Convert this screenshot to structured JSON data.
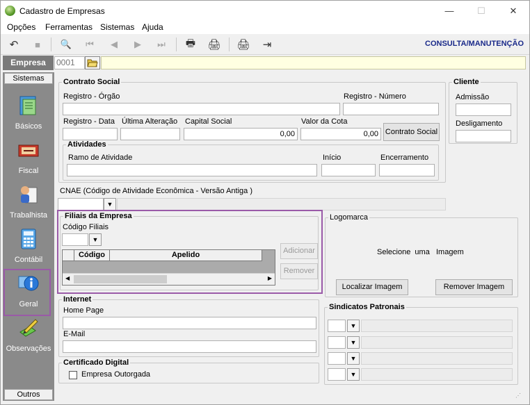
{
  "window": {
    "title": "Cadastro de Empresas",
    "min_glyph": "—",
    "max_glyph": "☐",
    "close_glyph": "✕"
  },
  "menu": [
    "Opções",
    "Ferramentas",
    "Sistemas",
    "Ajuda"
  ],
  "toolbar": {
    "mode_label": "CONSULTA/MANUTENÇÃO",
    "undo": "↶",
    "stop": "■",
    "preview": "🔍",
    "first": "⏮",
    "prev": "◀",
    "next": "▶",
    "last": "⏭",
    "print": "🖶",
    "print_setup": "🖨",
    "exit": "⇥"
  },
  "empresa": {
    "label": "Empresa",
    "code": "0001",
    "name": ""
  },
  "sidebar": {
    "header_top": "Sistemas",
    "header_bottom": "Outros",
    "items": [
      {
        "label": "Básicos",
        "icon": "basicos-icon"
      },
      {
        "label": "Fiscal",
        "icon": "fiscal-icon"
      },
      {
        "label": "Trabalhista",
        "icon": "trabalhista-icon"
      },
      {
        "label": "Contábil",
        "icon": "calculator-icon"
      },
      {
        "label": "Geral",
        "icon": "info-icon"
      },
      {
        "label": "Observações",
        "icon": "pencil-icon"
      }
    ]
  },
  "contrato": {
    "legend": "Contrato Social",
    "registro_orgao": "Registro - Órgão",
    "registro_numero": "Registro - Número",
    "registro_data": "Registro - Data",
    "ultima_alteracao": "Última Alteração",
    "capital_social": "Capital Social",
    "capital_social_value": "0,00",
    "valor_cota": "Valor da Cota",
    "valor_cota_value": "0,00",
    "button": "Contrato Social"
  },
  "atividades": {
    "legend": "Atividades",
    "ramo": "Ramo de Atividade",
    "inicio": "Início",
    "encerramento": "Encerramento"
  },
  "cliente": {
    "legend": "Cliente",
    "admissao": "Admissão",
    "desligamento": "Desligamento"
  },
  "cnae": {
    "label": "CNAE (Código de Atividade Econômica - Versão Antiga )"
  },
  "filiais": {
    "legend": "Filiais da Empresa",
    "codigo_label": "Código Filiais",
    "add": "Adicionar",
    "remove": "Remover",
    "columns": [
      "Código",
      "Apelido"
    ]
  },
  "logomarca": {
    "legend": "Logomarca",
    "placeholder": "Selecione  uma   Imagem",
    "locate": "Localizar Imagem",
    "remove": "Remover Imagem"
  },
  "internet": {
    "legend": "Internet",
    "home_page": "Home Page",
    "email": "E-Mail"
  },
  "sindicatos": {
    "legend": "Sindicatos Patronais"
  },
  "certificado": {
    "legend": "Certificado Digital",
    "checkbox": "Empresa Outorgada"
  },
  "colors": {
    "highlight": "#9a5aa8",
    "mode_label": "#1a2a8a",
    "name_field": "#ffffe1"
  }
}
